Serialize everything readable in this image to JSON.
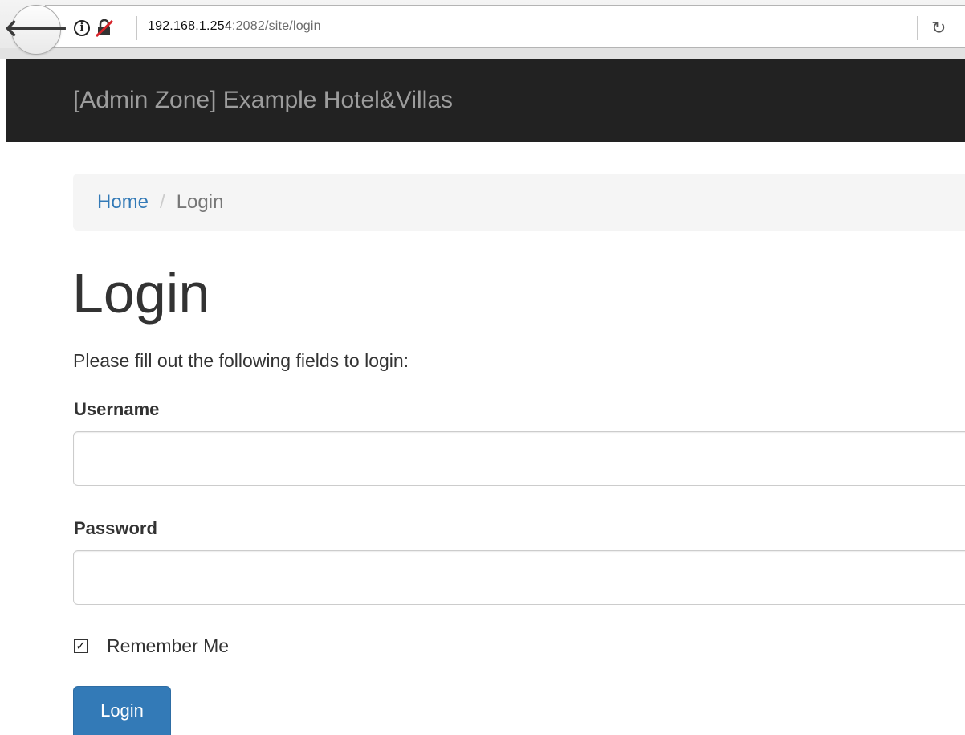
{
  "browser": {
    "back_icon": "back-arrow-icon",
    "info_icon": "info-icon",
    "insecure_icon": "insecure-lock-icon",
    "url_host": "192.168.1.254",
    "url_rest": ":2082/site/login",
    "reload_icon": "reload-icon"
  },
  "navbar": {
    "brand": "[Admin Zone] Example Hotel&Villas",
    "background": "#222222",
    "brand_color": "#9d9d9d"
  },
  "breadcrumb": {
    "home": "Home",
    "separator": "/",
    "active": "Login"
  },
  "main": {
    "title": "Login",
    "intro": "Please fill out the following fields to login:",
    "username_label": "Username",
    "username_value": "",
    "password_label": "Password",
    "password_value": "",
    "remember_label": "Remember Me",
    "remember_checked": true,
    "submit_label": "Login"
  },
  "colors": {
    "link": "#337ab7",
    "primary_button": "#337ab7",
    "breadcrumb_bg": "#f5f5f5"
  }
}
